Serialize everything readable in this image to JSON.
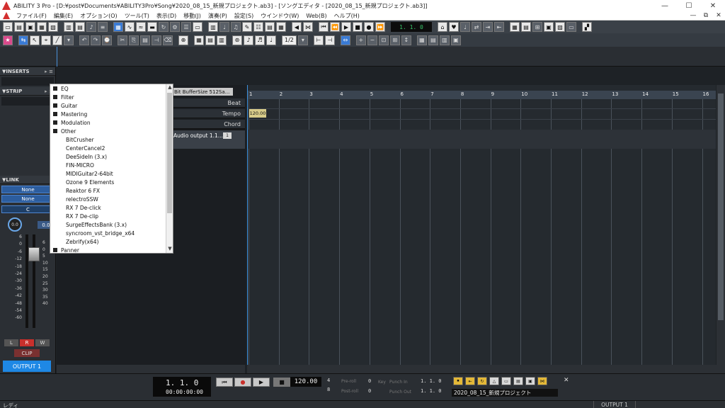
{
  "window": {
    "title": "ABILITY 3 Pro - [D:¥post¥Documents¥ABILITY3Pro¥Song¥2020_08_15_新規プロジェクト.ab3] - [ソングエディタ - [2020_08_15_新規プロジェクト.ab3]]",
    "minimize": "—",
    "maximize": "☐",
    "close": "✕"
  },
  "menu": {
    "items": [
      "ファイル(F)",
      "編集(E)",
      "オプション(O)",
      "ツール(T)",
      "表示(D)",
      "移動(J)",
      "演奏(P)",
      "設定(S)",
      "ウインドウ(W)",
      "Web(B)",
      "ヘルプ(H)"
    ],
    "mdi": [
      "—",
      "⧉",
      "✕"
    ]
  },
  "toolbar": {
    "counter": "1.  1.    0",
    "length_field": "1/2"
  },
  "left": {
    "inserts": "INSERTS",
    "strip": "STRIP",
    "link": "LINK",
    "none1": "None",
    "none2": "None",
    "pan": "C",
    "knob_val": "0.0",
    "vol_val": "0.0",
    "scale_left": [
      "6",
      "0",
      "-6",
      "-12",
      "-18",
      "-24",
      "-30",
      "-36",
      "-42",
      "-48",
      "-54",
      "-60"
    ],
    "scale_right": [
      "6",
      "0",
      "5",
      "10",
      "15",
      "20",
      "25",
      "30",
      "35",
      "40"
    ],
    "l": "L",
    "r": "R",
    "w": "W",
    "clip": "CLIP",
    "output": "OUTPUT 1"
  },
  "tracks": {
    "header": "Bit BufferSize 512Sa...",
    "beat": "Beat",
    "tempo": "Tempo",
    "chord": "Chord",
    "audio": "Audio output 1.1...",
    "audio_chip": "1"
  },
  "dropdown": {
    "items": [
      {
        "label": "EQ",
        "type": "cat",
        "state": "plus"
      },
      {
        "label": "Filter",
        "type": "cat",
        "state": "plus"
      },
      {
        "label": "Guitar",
        "type": "cat",
        "state": "plus"
      },
      {
        "label": "Mastering",
        "type": "cat",
        "state": "plus"
      },
      {
        "label": "Modulation",
        "type": "cat",
        "state": "plus"
      },
      {
        "label": "Other",
        "type": "cat",
        "state": "minus"
      },
      {
        "label": "BitCrusher",
        "type": "sub"
      },
      {
        "label": "CenterCancel2",
        "type": "sub"
      },
      {
        "label": "DeeSideIn (3.x)",
        "type": "sub"
      },
      {
        "label": "FIN-MICRO",
        "type": "sub"
      },
      {
        "label": "MIDIGuitar2-64bit",
        "type": "sub"
      },
      {
        "label": "Ozone 9 Elements",
        "type": "sub"
      },
      {
        "label": "Reaktor 6 FX",
        "type": "sub"
      },
      {
        "label": "relectroSSW",
        "type": "sub"
      },
      {
        "label": "RX 7 De-click",
        "type": "sub"
      },
      {
        "label": "RX 7 De-clip",
        "type": "sub"
      },
      {
        "label": "SurgeEffectsBank (3.x)",
        "type": "sub"
      },
      {
        "label": "syncroom_vst_bridge_x64",
        "type": "sub"
      },
      {
        "label": "Zebrify(x64)",
        "type": "sub"
      },
      {
        "label": "Panner",
        "type": "cat",
        "state": "plus"
      }
    ]
  },
  "timeline": {
    "bars": [
      "1",
      "2",
      "3",
      "4",
      "5",
      "6",
      "7",
      "8",
      "9",
      "10",
      "11",
      "12",
      "13",
      "14",
      "15",
      "16"
    ],
    "tempo_event": "120.00"
  },
  "transport": {
    "position": "1.  1.    0",
    "time": "00:00:00:00",
    "rewind": "⏮",
    "record": "●",
    "play": "▶",
    "stop": "■",
    "tempo": "120.00",
    "meter_num": "4",
    "meter_den": "8",
    "preroll_label": "Pre-roll",
    "preroll_val": "0",
    "postroll_label": "Post-roll",
    "postroll_val": "0",
    "key_label": "Key",
    "punch_in_label": "Punch In",
    "punch_in_val": "1.  1.    0",
    "punch_out_label": "Punch Out",
    "punch_out_val": "1.  1.    0",
    "project": "2020_08_15_新規プロジェクト",
    "close": "✕"
  },
  "status": {
    "text": "レディ",
    "output": "OUTPUT 1"
  }
}
